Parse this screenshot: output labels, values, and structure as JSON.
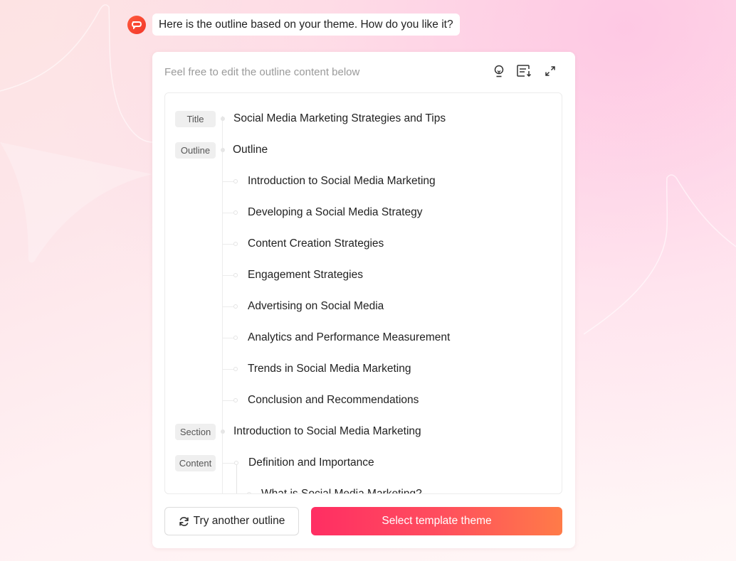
{
  "assistant": {
    "avatar_icon": "speech-bubble-logo-icon",
    "message": "Here is the outline based on your theme. How do you like it?"
  },
  "card": {
    "header": "Feel free to edit the outline content below",
    "header_icons": [
      "lightbulb-icon",
      "list-download-icon",
      "expand-icon"
    ]
  },
  "outline": {
    "title_tag": "Title",
    "title": "Social Media Marketing Strategies and Tips",
    "outline_tag": "Outline",
    "outline_heading": "Outline",
    "outline_items": [
      "Introduction to Social Media Marketing",
      "Developing a Social Media Strategy",
      "Content Creation Strategies",
      "Engagement Strategies",
      "Advertising on Social Media",
      "Analytics and Performance Measurement",
      "Trends in Social Media Marketing",
      "Conclusion and Recommendations"
    ],
    "section_tag": "Section",
    "section_title": "Introduction to Social Media Marketing",
    "content_tag": "Content",
    "content_heading": "Definition and Importance",
    "content_sub_item": "What is Social Media Marketing?"
  },
  "buttons": {
    "retry_icon": "refresh-icon",
    "retry_label": "Try another outline",
    "select_label": "Select template theme"
  },
  "colors": {
    "accent_start": "#ff2e63",
    "accent_end": "#ff7b48",
    "avatar": "#f2372a"
  }
}
